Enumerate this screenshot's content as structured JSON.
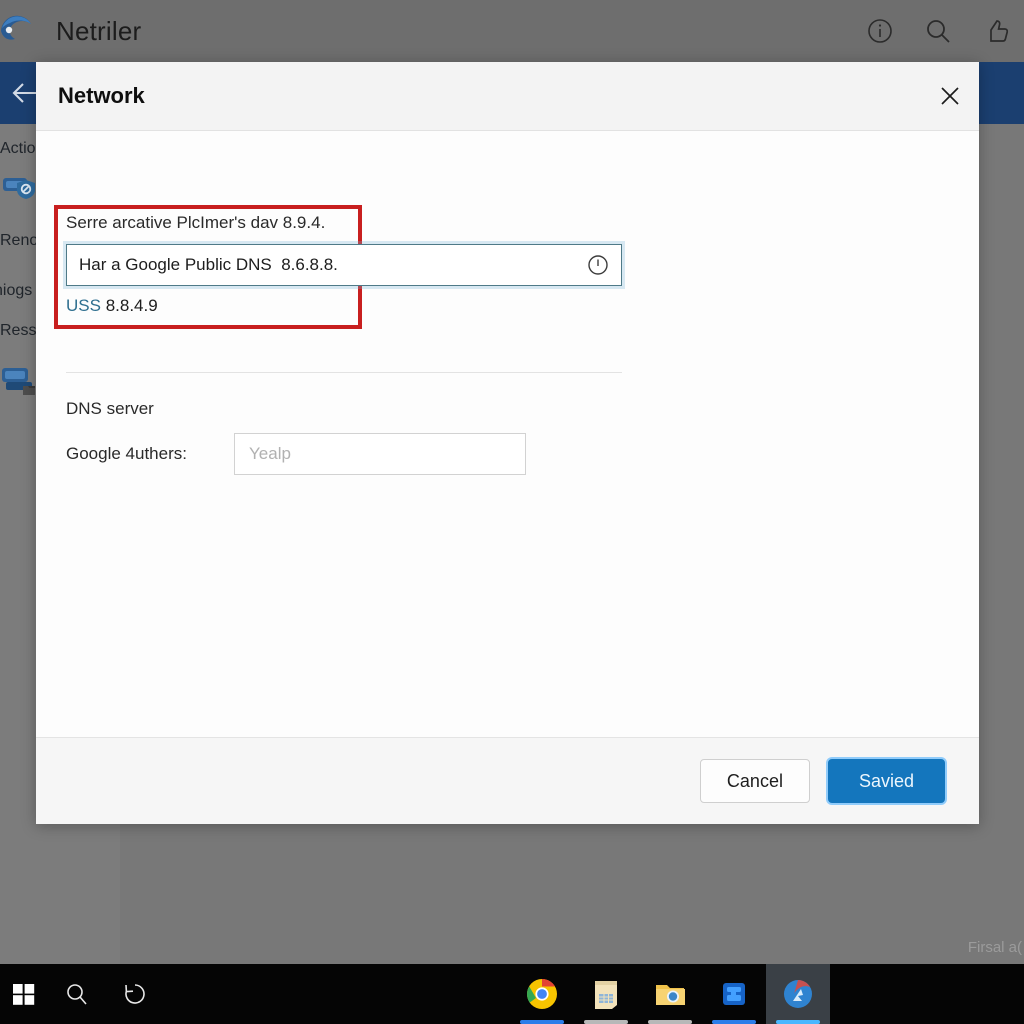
{
  "app": {
    "title": "Netriler",
    "logo_icon": "edge-logo-icon",
    "titlebar_icons": [
      "info-icon",
      "search-icon",
      "thumbs-up-icon"
    ],
    "back_icon": "back-arrow-icon",
    "sidebar_items": [
      {
        "label": "Actio",
        "icon": null
      },
      {
        "label": "",
        "icon": "network-shield-icon"
      },
      {
        "label": "Reno",
        "icon": null
      },
      {
        "label": "niogs",
        "icon": null
      },
      {
        "label": "Ressi",
        "icon": null
      },
      {
        "label": "",
        "icon": "device-folder-icon"
      }
    ],
    "status_text": "Firsal a("
  },
  "modal": {
    "title": "Network",
    "close_icon": "close-icon",
    "primary_label": "Serre arcative PlcImer's dav 8.9.4.",
    "dns_input_value": "Har a Google Public DNS  8.6.8.8.",
    "dns_input_placeholder": "",
    "dns_input_icon": "alert-circle-icon",
    "secondary_prefix": "USS",
    "secondary_value": "8.8.4.9",
    "section_title": "DNS server",
    "auth_label": "Google 4uthers:",
    "auth_value": "",
    "auth_placeholder": "Yealp",
    "cancel_label": "Cancel",
    "save_label": "Savied"
  },
  "taskbar": {
    "start_icon": "windows-start-icon",
    "search_icon": "search-icon",
    "taskview_icon": "task-view-icon",
    "apps": [
      {
        "name": "chrome-icon",
        "accent": "#2b7de9"
      },
      {
        "name": "notepad-icon",
        "accent": "#b8b8b8"
      },
      {
        "name": "file-explorer-icon",
        "accent": "#b8b8b8"
      },
      {
        "name": "storage-app-icon",
        "accent": "#2b7de9"
      },
      {
        "name": "browser-app-icon",
        "accent": "#49b7ff"
      }
    ]
  },
  "colors": {
    "accent": "#1476bd",
    "highlight": "#c81f1f",
    "navband": "#1b3f70",
    "link": "#2f6f8f"
  }
}
